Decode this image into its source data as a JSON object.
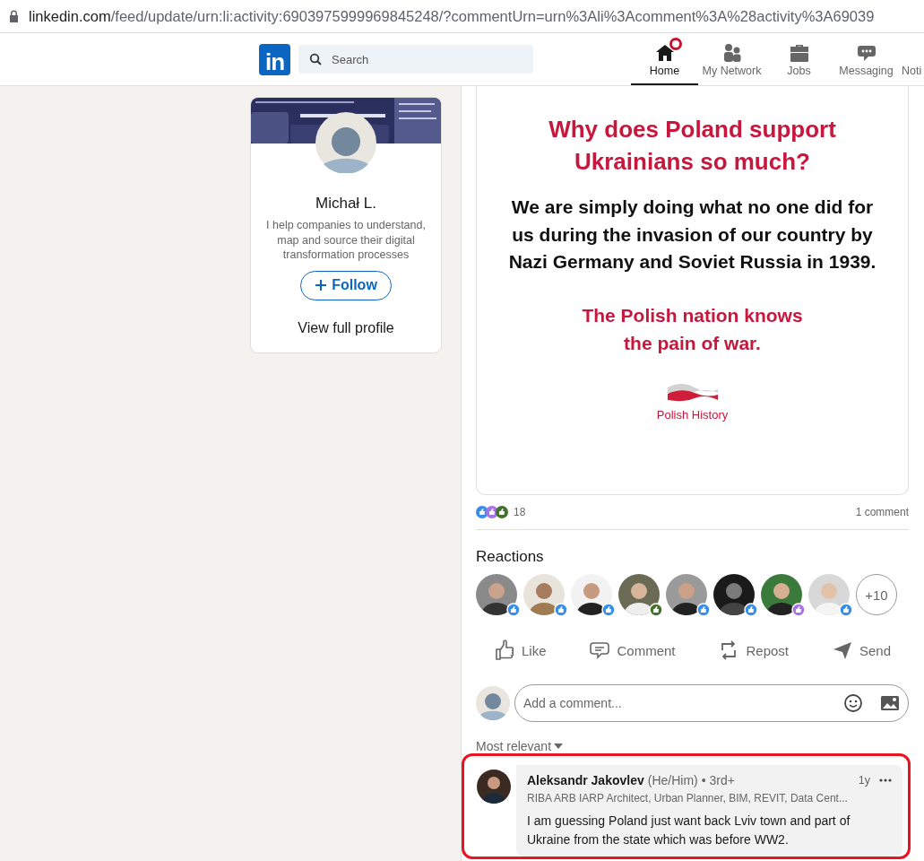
{
  "address_bar": {
    "domain": "linkedin.com",
    "path": "/feed/update/urn:li:activity:6903975999969845248/?commentUrn=urn%3Ali%3Acomment%3A%28activity%3A69039"
  },
  "nav": {
    "logo": "in",
    "search": {
      "placeholder": "Search"
    },
    "items": [
      {
        "label": "Home",
        "kind": "home",
        "selected": true,
        "badge": true
      },
      {
        "label": "My Network",
        "kind": "network",
        "selected": false,
        "badge": false
      },
      {
        "label": "Jobs",
        "kind": "jobs",
        "selected": false,
        "badge": false
      },
      {
        "label": "Messaging",
        "kind": "messaging",
        "selected": false,
        "badge": false
      },
      {
        "label": "Noti",
        "kind": "cut",
        "selected": false,
        "badge": false
      }
    ]
  },
  "profile": {
    "name": "Michał L.",
    "headline": "I help companies to understand, map and source their digital transformation processes",
    "follow": "Follow",
    "view_profile": "View full profile"
  },
  "post_image": {
    "title": "Why does Poland support Ukrainians so much?",
    "body": "We are simply doing what no one did for us during the invasion of our country by Nazi Germany and Soviet Russia in 1939.",
    "closing": "The Polish nation knows the pain of war.",
    "logo_text": "Polish History"
  },
  "social": {
    "reactions": [
      {
        "kind": "like"
      },
      {
        "kind": "support"
      },
      {
        "kind": "celebrate"
      }
    ],
    "count": "18",
    "comments": "1 comment"
  },
  "reactions": {
    "title": "Reactions",
    "people": [
      {
        "kind": "like"
      },
      {
        "kind": "like"
      },
      {
        "kind": "like"
      },
      {
        "kind": "celebrate"
      },
      {
        "kind": "like"
      },
      {
        "kind": "like"
      },
      {
        "kind": "support"
      },
      {
        "kind": "like"
      }
    ],
    "more": "+10"
  },
  "actions": [
    {
      "label": "Like",
      "kind": "like"
    },
    {
      "label": "Comment",
      "kind": "comment"
    },
    {
      "label": "Repost",
      "kind": "repost"
    },
    {
      "label": "Send",
      "kind": "send"
    }
  ],
  "comment_box": {
    "placeholder": "Add a comment..."
  },
  "sort": "Most relevant",
  "comments": [
    {
      "author": "Aleksandr Jakovlev",
      "pronouns": "(He/Him)",
      "degree": "• 3rd+",
      "headline": "RIBA ARB IARP Architect, Urban Planner, BIM, REVIT, Data Cent...",
      "time": "1y",
      "text": "I am guessing Poland just want back Lviv town and part of Ukraine from the state which was before WW2.",
      "highlighted": true
    }
  ]
}
